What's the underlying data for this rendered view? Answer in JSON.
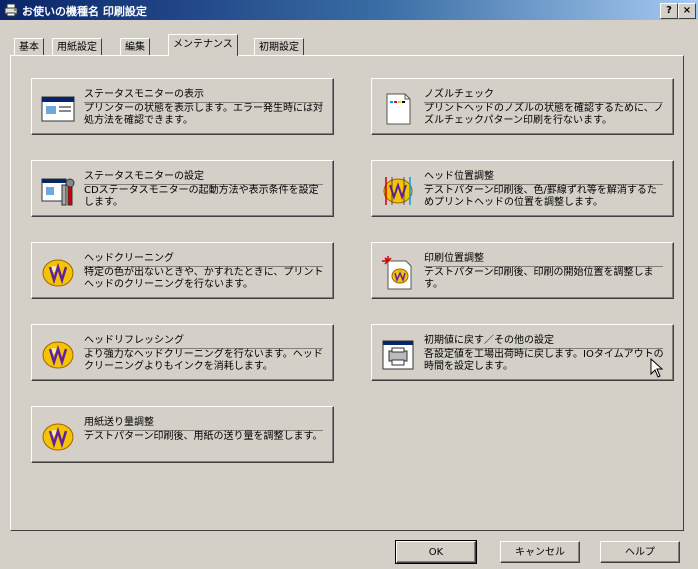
{
  "window": {
    "title": "お使いの機種名 印刷設定",
    "help_button": "?",
    "close_button": "×"
  },
  "tabs": [
    {
      "label": "基本"
    },
    {
      "label": "用紙設定"
    },
    {
      "label": "編集"
    },
    {
      "label": "メンテナンス"
    },
    {
      "label": "初期設定"
    }
  ],
  "active_tab": "メンテナンス",
  "maintenance": {
    "status_monitor_display": {
      "title": "ステータスモニターの表示",
      "description": "プリンターの状態を表示します。エラー発生時には対処方法を確認できます。",
      "icon": "status-monitor-window-icon"
    },
    "nozzle_check": {
      "title": "ノズルチェック",
      "description": "プリントヘッドのノズルの状態を確認するために、ノズルチェックパターン印刷を行ないます。",
      "icon": "nozzle-check-page-icon"
    },
    "status_monitor_settings": {
      "title": "ステータスモニターの設定",
      "description": "CDステータスモニターの起動方法や表示条件を設定します。",
      "icon": "status-monitor-settings-icon"
    },
    "head_alignment": {
      "title": "ヘッド位置調整",
      "description": "テストパターン印刷後、色/罫線ずれ等を解消するためプリントヘッドの位置を調整します。",
      "icon": "head-alignment-icon"
    },
    "head_cleaning": {
      "title": "ヘッドクリーニング",
      "description": "特定の色が出ないときや、かすれたときに、プリントヘッドのクリーニングを行ないます。",
      "icon": "head-cleaning-icon"
    },
    "print_position": {
      "title": "印刷位置調整",
      "description": "テストパターン印刷後、印刷の開始位置を調整します。",
      "icon": "print-position-icon"
    },
    "head_refreshing": {
      "title": "ヘッドリフレッシング",
      "description": "より強力なヘッドクリーニングを行ないます。ヘッドクリーニングよりもインクを消耗します。",
      "icon": "head-refresh-icon"
    },
    "reset_settings": {
      "title": "初期値に戻す／その他の設定",
      "description": "各設定値を工場出荷時に戻します。IOタイムアウトの時間を設定します。",
      "icon": "reset-settings-icon"
    },
    "paper_feed": {
      "title": "用紙送り量調整",
      "description": "テストパターン印刷後、用紙の送り量を調整します。",
      "icon": "paper-feed-icon"
    }
  },
  "footer": {
    "ok_label": "OK",
    "cancel_label": "キャンセル",
    "help_label": "ヘルプ"
  },
  "colors": {
    "dialog_face": "#d4d0c8",
    "titlebar_start": "#0a246a",
    "titlebar_end": "#a6caf0"
  }
}
